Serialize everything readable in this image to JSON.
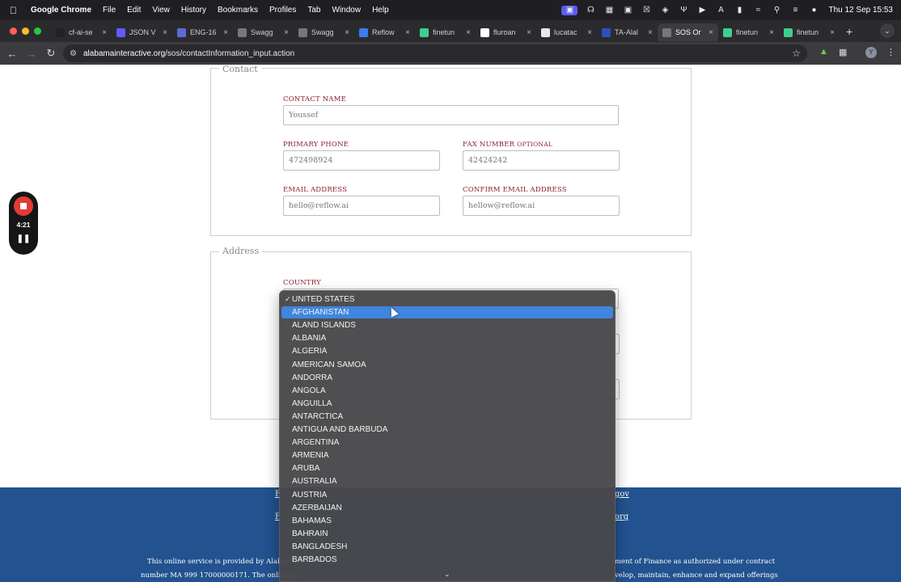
{
  "menubar": {
    "app": "Google Chrome",
    "items": [
      "File",
      "Edit",
      "View",
      "History",
      "Bookmarks",
      "Profiles",
      "Tab",
      "Window",
      "Help"
    ],
    "clock": "Thu 12 Sep  15:53"
  },
  "tabs": [
    {
      "title": "cf-ai-se",
      "icon": "github-icon",
      "color": "#222222"
    },
    {
      "title": "JSON V",
      "icon": "stripe-icon",
      "color": "#635bff"
    },
    {
      "title": "ENG-16",
      "icon": "linear-icon",
      "color": "#5e6ad2"
    },
    {
      "title": "Swagg",
      "icon": "globe-icon",
      "color": "#777777"
    },
    {
      "title": "Swagg",
      "icon": "globe-icon",
      "color": "#777777"
    },
    {
      "title": "Reflow",
      "icon": "reflow-icon",
      "color": "#3b7cf0"
    },
    {
      "title": "finetun",
      "icon": "supabase-icon",
      "color": "#3ecf8e"
    },
    {
      "title": "fluroan",
      "icon": "google-icon",
      "color": "#ffffff"
    },
    {
      "title": "lucatac",
      "icon": "doc-icon",
      "color": "#e8e8e8"
    },
    {
      "title": "TA-Alal",
      "icon": "shield-icon",
      "color": "#2f4fbf"
    },
    {
      "title": "SOS Or",
      "icon": "globe-icon",
      "color": "#777777",
      "active": true
    },
    {
      "title": "finetun",
      "icon": "supabase-icon",
      "color": "#3ecf8e"
    },
    {
      "title": "finetun",
      "icon": "supabase-icon",
      "color": "#3ecf8e"
    }
  ],
  "address": {
    "url_domain": "alabamainteractive.org",
    "url_path": "/sos/contactInformation_input.action"
  },
  "contact": {
    "legend": "Contact",
    "name_label": "CONTACT NAME",
    "name_value": "Youssef",
    "phone_label": "PRIMARY PHONE",
    "phone_value": "472498924",
    "fax_label": "FAX NUMBER",
    "fax_optional": "OPTIONAL",
    "fax_value": "42424242",
    "email_label": "EMAIL ADDRESS",
    "email_value": "hello@reflow.ai",
    "confirm_label": "CONFIRM EMAIL ADDRESS",
    "confirm_value": "hellow@reflow.ai"
  },
  "address_section": {
    "legend": "Address",
    "country_label": "COUNTRY"
  },
  "recorder": {
    "time": "4:21"
  },
  "footer": {
    "line1_left": "This online service is provided by Alabama",
    "line1_right": "ment of Finance as authorized under contract",
    "line2_left": "number MA 999 17000000171. The online pr",
    "line2_right": "velop, maintain, enhance and expand offerings",
    "link1": "gov",
    "link2": "org",
    "link_left1": "F",
    "link_left2": "F"
  },
  "dropdown": {
    "checked": "UNITED STATES",
    "highlighted": "AFGHANISTAN",
    "options": [
      "UNITED STATES",
      "AFGHANISTAN",
      "ALAND ISLANDS",
      "ALBANIA",
      "ALGERIA",
      "AMERICAN SAMOA",
      "ANDORRA",
      "ANGOLA",
      "ANGUILLA",
      "ANTARCTICA",
      "ANTIGUA AND BARBUDA",
      "ARGENTINA",
      "ARMENIA",
      "ARUBA",
      "AUSTRALIA",
      "AUSTRIA",
      "AZERBAIJAN",
      "BAHAMAS",
      "BAHRAIN",
      "BANGLADESH",
      "BARBADOS"
    ]
  }
}
